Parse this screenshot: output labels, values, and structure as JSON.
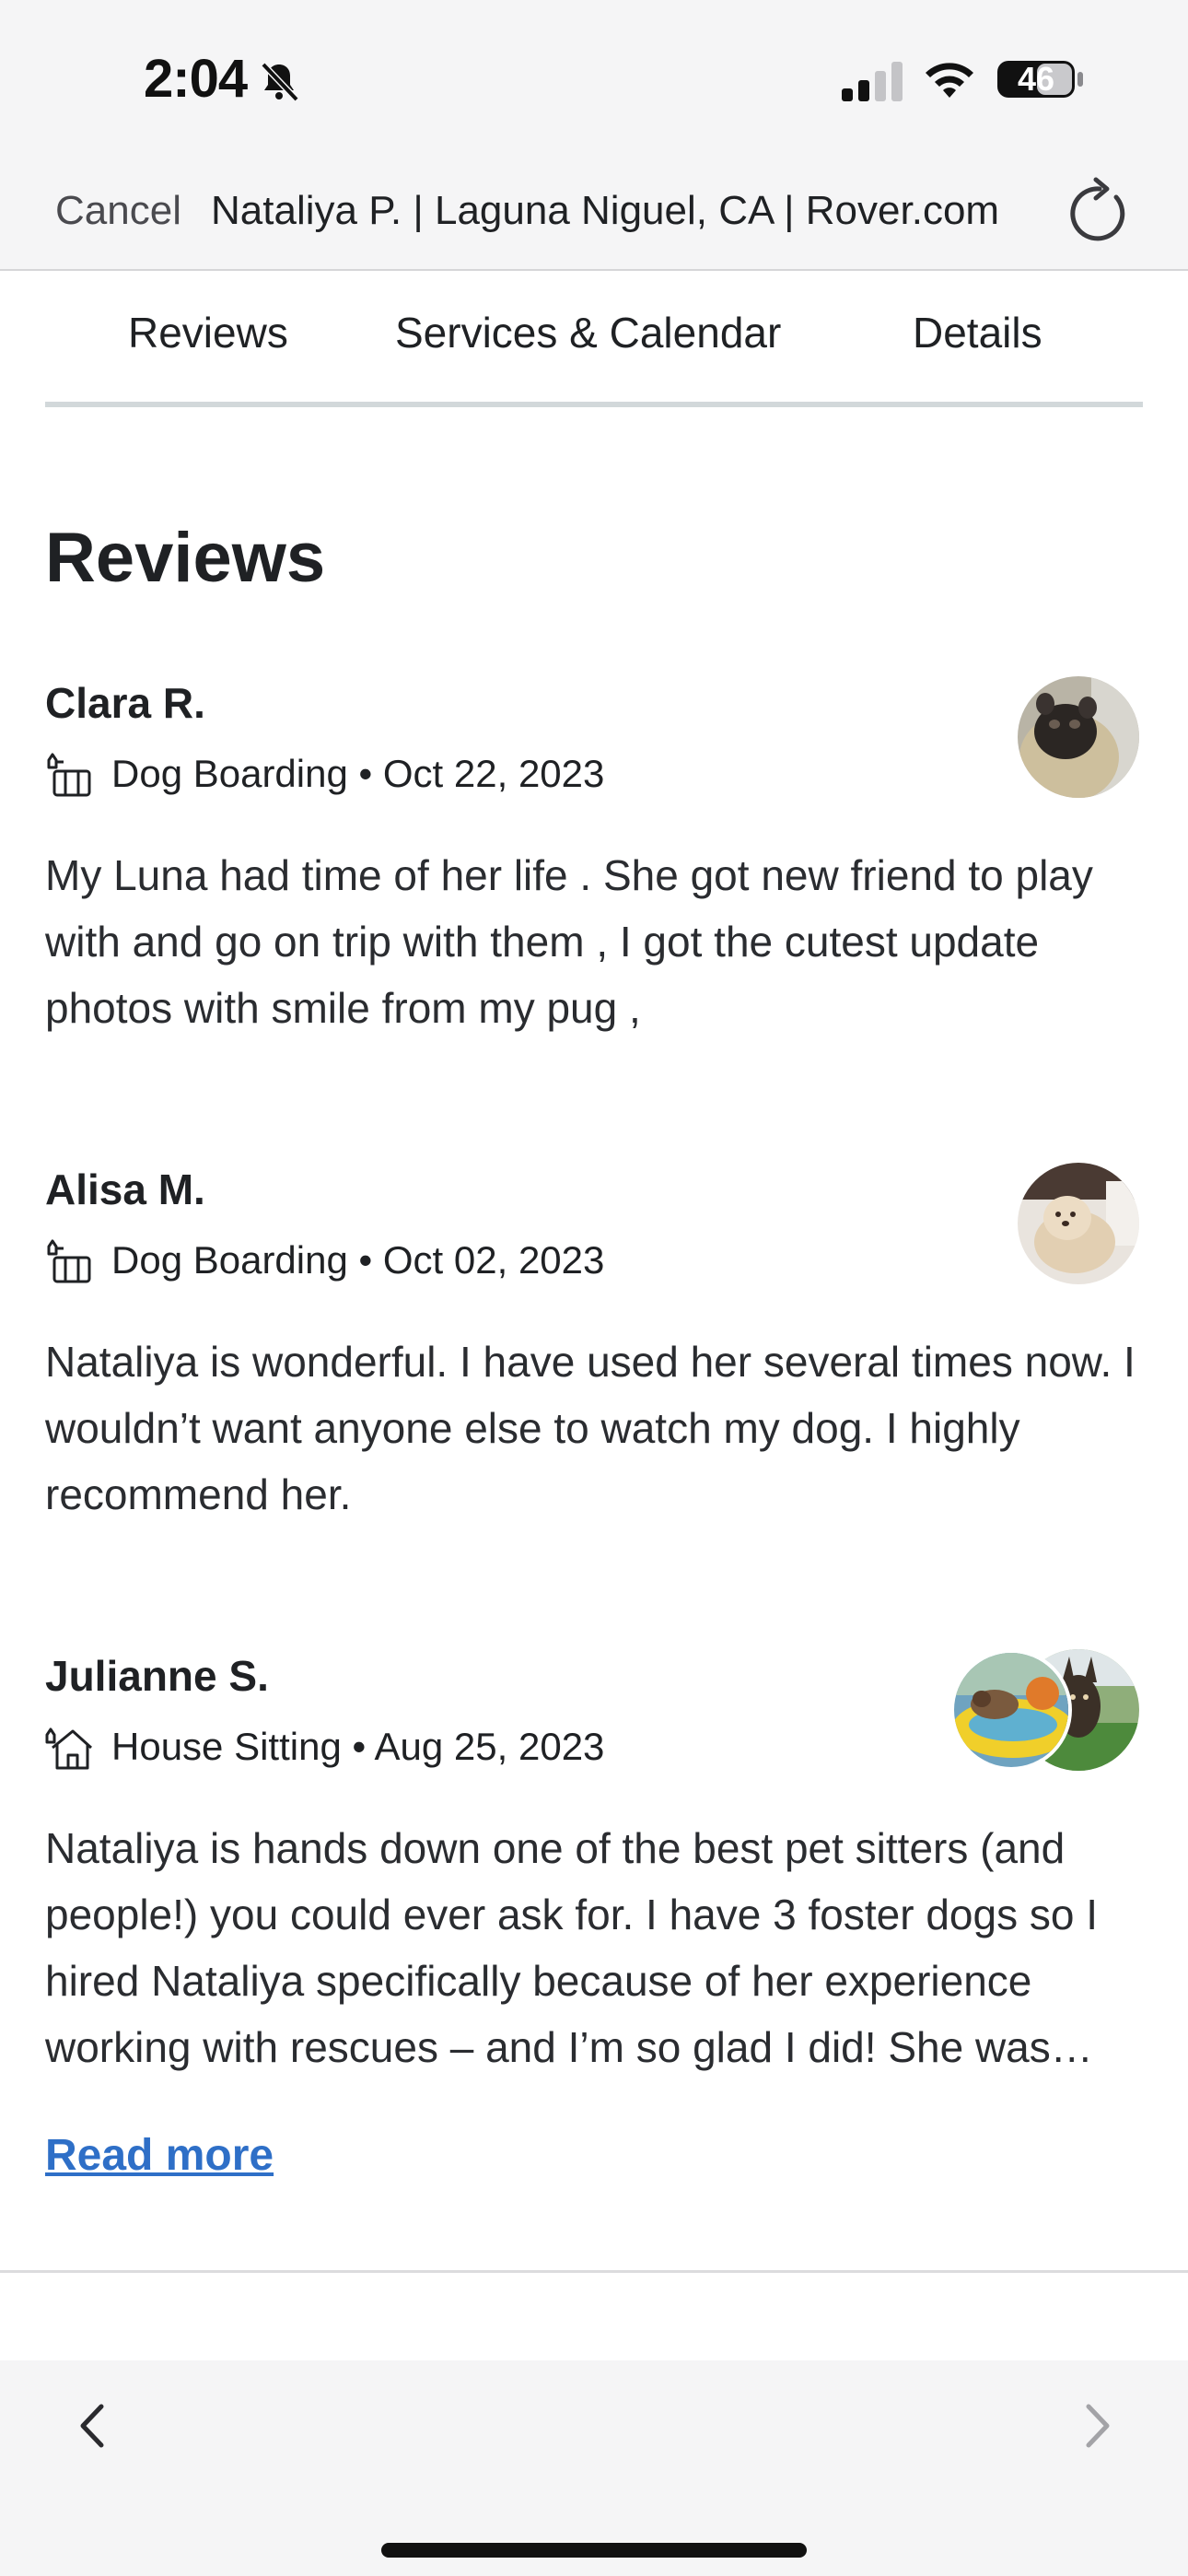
{
  "status_bar": {
    "time": "2:04",
    "battery": "46",
    "icons": [
      "bell-slash-icon",
      "cellular-signal-icon",
      "wifi-icon",
      "battery-icon"
    ]
  },
  "browser": {
    "cancel_label": "Cancel",
    "title": "Nataliya P. | Laguna Niguel, CA | Rover.com",
    "reload_icon": "reload-icon"
  },
  "tabs": [
    {
      "label": "Reviews"
    },
    {
      "label": "Services & Calendar"
    },
    {
      "label": "Details"
    }
  ],
  "section_title": "Reviews",
  "reviews": [
    {
      "name": "Clara R.",
      "service": "Dog Boarding",
      "date": "Oct 22, 2023",
      "meta": "Dog Boarding • Oct 22, 2023",
      "service_icon": "dog-boarding-icon",
      "text": "My Luna had time of her life . She got new friend to play with and go on trip with them , I got the cutest update photos with smile from my pug ,"
    },
    {
      "name": "Alisa M.",
      "service": "Dog Boarding",
      "date": "Oct 02, 2023",
      "meta": "Dog Boarding • Oct 02, 2023",
      "service_icon": "dog-boarding-icon",
      "text": "Nataliya is wonderful. I have used her several times now. I wouldn’t want anyone else to watch my dog. I highly recommend her."
    },
    {
      "name": "Julianne S.",
      "service": "House Sitting",
      "date": "Aug 25, 2023",
      "meta": "House Sitting • Aug 25, 2023",
      "service_icon": "house-sitting-icon",
      "text": "Nataliya is hands down one of the best pet sitters (and people!) you could ever ask for. I have 3 foster dogs so I hired Nataliya specifically because of her experience working with rescues – and I’m so glad I did! She was…"
    }
  ],
  "read_more_label": "Read more",
  "colors": {
    "link": "#2e6fc7",
    "text": "#1f2124",
    "tab_underline": "#d2d8da",
    "chrome_bg": "#f5f5f6"
  }
}
